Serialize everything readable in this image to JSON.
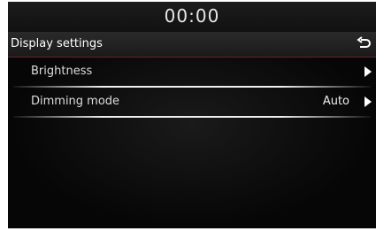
{
  "status": {
    "time": "00:00"
  },
  "header": {
    "title": "Display settings"
  },
  "menu": {
    "items": [
      {
        "label": "Brightness",
        "value": ""
      },
      {
        "label": "Dimming mode",
        "value": "Auto"
      }
    ]
  },
  "colors": {
    "accent": "#7a1a1a",
    "background": "#050505",
    "text": "#dddddd"
  }
}
